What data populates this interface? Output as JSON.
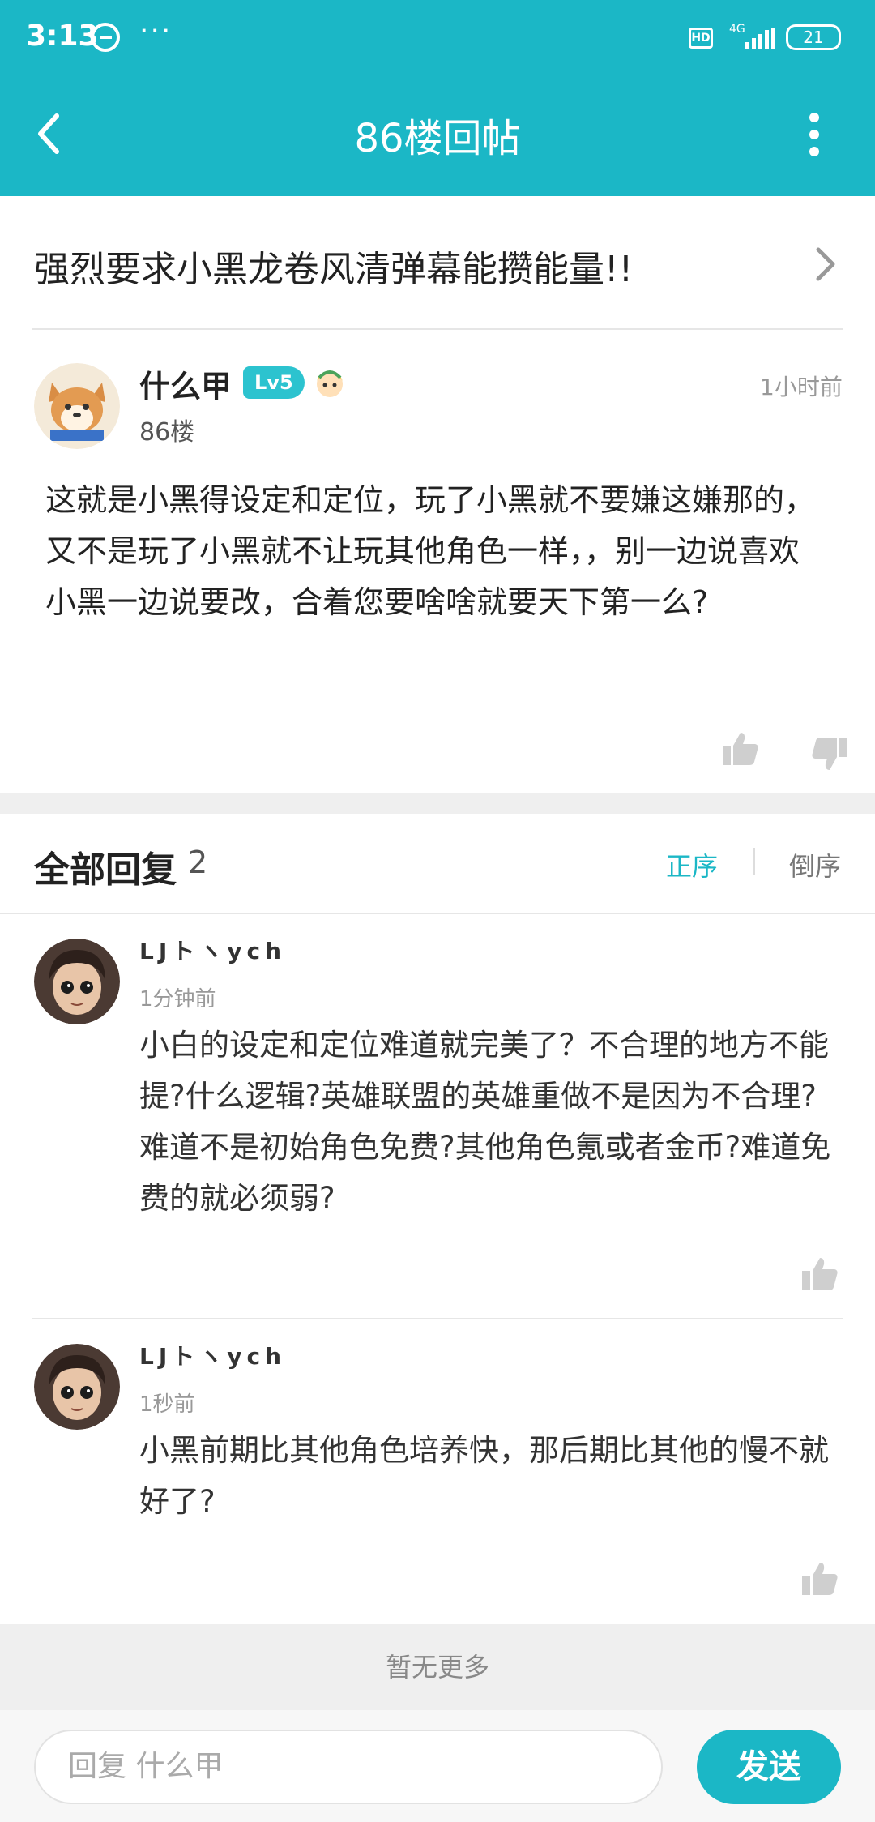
{
  "status_bar": {
    "time": "3:13",
    "more": "···",
    "hd": "HD",
    "network": "4G",
    "battery": "21"
  },
  "header": {
    "title": "86楼回帖",
    "back_icon": "chevron-left-icon",
    "more_icon": "vertical-dots-icon"
  },
  "topic": {
    "title": "强烈要求小黑龙卷风清弹幕能攒能量!!"
  },
  "post": {
    "author": "什么甲",
    "level": "Lv5",
    "floor": "86楼",
    "time": "1小时前",
    "content": "这就是小黑得设定和定位，玩了小黑就不要嫌这嫌那的，又不是玩了小黑就不让玩其他角色一样，，别一边说喜欢小黑一边说要改，合着您要啥啥就要天下第一么?"
  },
  "replies_header": {
    "title": "全部回复",
    "count": "2",
    "sort_asc": "正序",
    "sort_desc": "倒序"
  },
  "replies": [
    {
      "author": "LJトヽych",
      "time": "1分钟前",
      "content": "小白的设定和定位难道就完美了？不合理的地方不能提?什么逻辑?英雄联盟的英雄重做不是因为不合理?难道不是初始角色免费?其他角色氪或者金币?难道免费的就必须弱?"
    },
    {
      "author": "LJトヽych",
      "time": "1秒前",
      "content": "小黑前期比其他角色培养快，那后期比其他的慢不就好了?"
    }
  ],
  "footer": {
    "no_more": "暂无更多",
    "reply_placeholder": "回复 什么甲",
    "send": "发送"
  },
  "colors": {
    "accent": "#1bb7c6",
    "level_badge": "#2cc3cf"
  }
}
